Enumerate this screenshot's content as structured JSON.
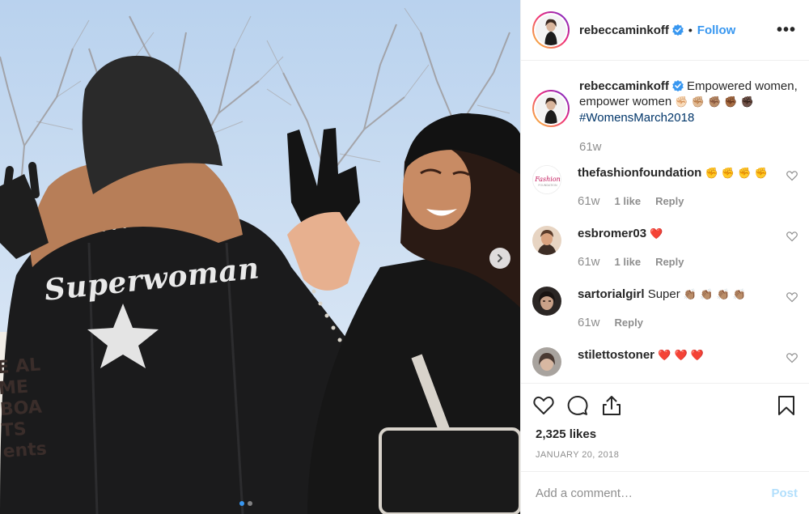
{
  "header": {
    "username": "rebeccaminkoff",
    "verified": true,
    "separator": "•",
    "follow_label": "Follow",
    "more_label": "•••"
  },
  "photo": {
    "jacket_text": "Superwoman",
    "sign_text": "E AL\nME BOA\nTS\nents",
    "carousel": {
      "count": 2,
      "active_index": 0
    }
  },
  "caption": {
    "username": "rebeccaminkoff",
    "text": "Empowered women, empower women",
    "emoji": "✊🏻 ✊🏼 ✊🏽 ✊🏾 ✊🏿",
    "hashtag": "#WomensMarch2018",
    "time": "61w"
  },
  "comments": [
    {
      "username": "thefashionfoundation",
      "text": "",
      "emoji": "✊ ✊ ✊ ✊",
      "time": "61w",
      "likes": "1 like",
      "reply": "Reply",
      "avatar": "fashion-foundation-logo"
    },
    {
      "username": "esbromer03",
      "text": "",
      "emoji": "❤️",
      "time": "61w",
      "likes": "1 like",
      "reply": "Reply",
      "avatar": "user-photo"
    },
    {
      "username": "sartorialgirl",
      "text": "Super",
      "emoji": "👏🏽 👏🏽 👏🏽 👏🏽",
      "time": "61w",
      "likes": "",
      "reply": "Reply",
      "avatar": "user-photo"
    },
    {
      "username": "stilettostoner",
      "text": "",
      "emoji": "❤️ ❤️ ❤️",
      "time": "",
      "likes": "",
      "reply": "",
      "avatar": "user-photo"
    }
  ],
  "engagement": {
    "likes": "2,325 likes",
    "date": "JANUARY 20, 2018"
  },
  "add_comment": {
    "placeholder": "Add a comment…",
    "post_label": "Post"
  },
  "colors": {
    "accent": "#3897f0",
    "hashtag": "#003569",
    "muted": "#8e8e8e",
    "post_disabled": "#b2dffc",
    "heart_red": "#ed4956"
  }
}
